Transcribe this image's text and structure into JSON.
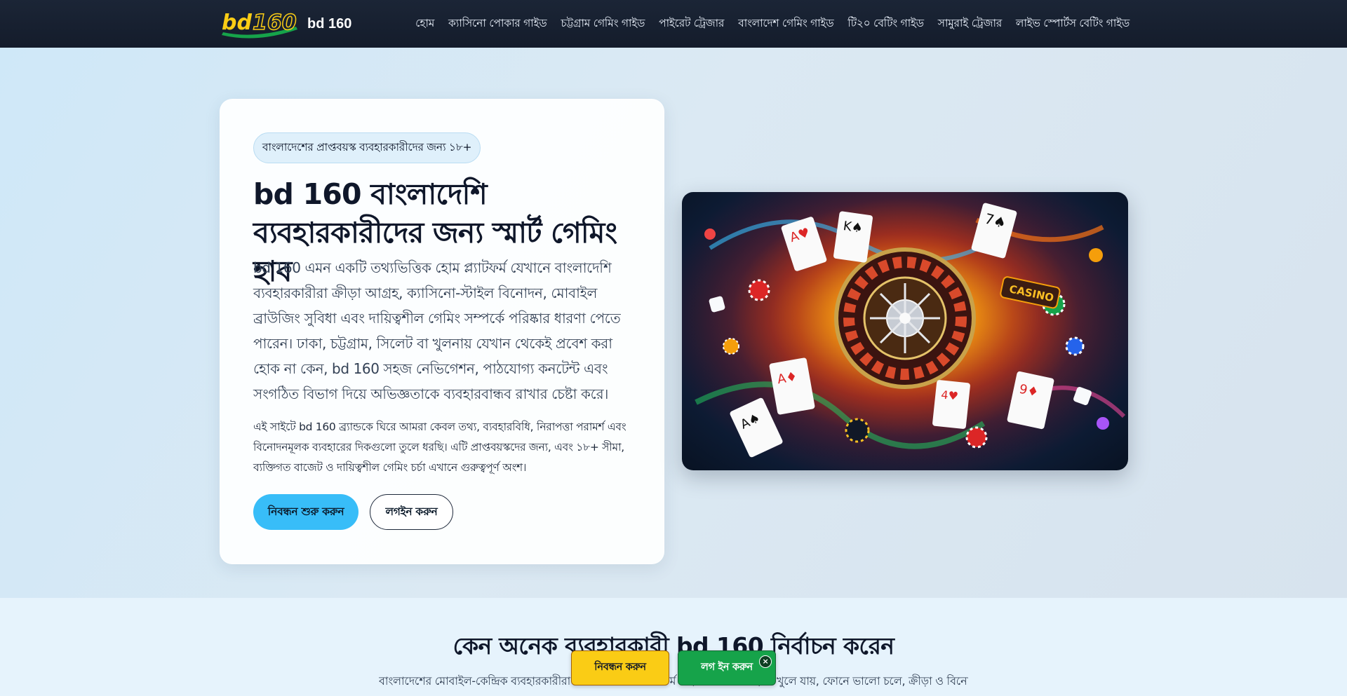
{
  "nav": {
    "brand_text": "bd 160",
    "logo_text": "bd 160",
    "links": [
      "হোম",
      "ক্যাসিনো পোকার গাইড",
      "চট্টগ্রাম গেমিং গাইড",
      "পাইরেট ট্রেজার",
      "বাংলাদেশ গেমিং গাইড",
      "টি২০ বেটিং গাইড",
      "সামুরাই ট্রেজার",
      "লাইভ স্পোর্টস বেটিং গাইড"
    ]
  },
  "hero": {
    "badge": "বাংলাদেশের প্রাপ্তবয়স্ক ব্যবহারকারীদের জন্য ১৮+",
    "title": "bd 160 বাংলাদেশি ব্যবহারকারীদের জন্য স্মার্ট গেমিং হাব",
    "lead": "bd 160 এমন একটি তথ্যভিত্তিক হোম প্ল্যাটফর্ম যেখানে বাংলাদেশি ব্যবহারকারীরা ক্রীড়া আগ্রহ, ক্যাসিনো-স্টাইল বিনোদন, মোবাইল ব্রাউজিং সুবিধা এবং দায়িত্বশীল গেমিং সম্পর্কে পরিষ্কার ধারণা পেতে পারেন। ঢাকা, চট্টগ্রাম, সিলেট বা খুলনায় যেখান থেকেই প্রবেশ করা হোক না কেন, bd 160 সহজ নেভিগেশন, পাঠযোগ্য কনটেন্ট এবং সংগঠিত বিভাগ দিয়ে অভিজ্ঞতাকে ব্যবহারবান্ধব রাখার চেষ্টা করে।",
    "note": "এই সাইটে bd 160 ব্র্যান্ডকে ঘিরে আমরা কেবল তথ্য, ব্যবহারবিধি, নিরাপত্তা পরামর্শ এবং বিনোদনমূলক ব্যবহারের দিকগুলো তুলে ধরছি। এটি প্রাপ্তবয়স্কদের জন্য, এবং ১৮+ সীমা, ব্যক্তিগত বাজেট ও দায়িত্বশীল গেমিং চর্চা এখানে গুরুত্বপূর্ণ অংশ।",
    "primary_button": "নিবন্ধন শুরু করুন",
    "secondary_button": "লগইন করুন",
    "image_label": "CASINO"
  },
  "section2": {
    "title": "কেন অনেক ব্যবহারকারী bd 160 নির্বাচন করেন",
    "text": "বাংলাদেশের মোবাইল-কেন্দ্রিক ব্যবহারকারীরা সাধারণত এমন প্ল্যাটফর্ম পছন্দ করেন যা সহজে খুলে যায়, ফোনে ভালো চলে, ক্রীড়া ও বিনোদন বিভাগ"
  },
  "sticky": {
    "register": "নিবন্ধন করুন",
    "login": "লগ ইন করুন",
    "close": "×"
  },
  "colors": {
    "nav_bg": "#1b2536",
    "primary": "#38bdf8",
    "sticky_register": "#facc15",
    "sticky_login": "#16a34a"
  }
}
